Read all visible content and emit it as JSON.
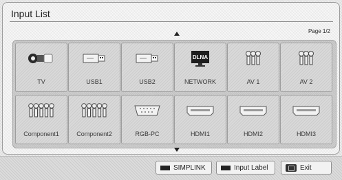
{
  "window": {
    "title": "Input List",
    "page_indicator": "Page 1/2"
  },
  "inputs": [
    {
      "label": "TV",
      "icon": "tv-antenna-icon"
    },
    {
      "label": "USB1",
      "icon": "usb-icon"
    },
    {
      "label": "USB2",
      "icon": "usb-icon"
    },
    {
      "label": "NETWORK",
      "icon": "dlna-network-icon",
      "badge": "DLNA"
    },
    {
      "label": "AV 1",
      "icon": "av-rca-icon"
    },
    {
      "label": "AV 2",
      "icon": "av-rca-icon"
    },
    {
      "label": "Component1",
      "icon": "component-rca-icon"
    },
    {
      "label": "Component2",
      "icon": "component-rca-icon"
    },
    {
      "label": "RGB-PC",
      "icon": "rgb-port-icon"
    },
    {
      "label": "HDMI1",
      "icon": "hdmi-port-icon"
    },
    {
      "label": "HDMI2",
      "icon": "hdmi-port-icon"
    },
    {
      "label": "HDMI3",
      "icon": "hdmi-port-icon"
    }
  ],
  "bottom_bar": {
    "simplink_label": "SIMPLINK",
    "input_label_label": "Input Label",
    "exit_label": "Exit"
  }
}
